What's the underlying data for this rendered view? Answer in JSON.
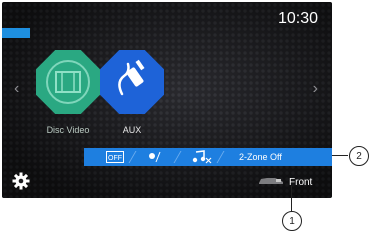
{
  "status": {
    "clock": "10:30"
  },
  "apps": [
    {
      "label": "Disc Video",
      "icon": "film-icon"
    },
    {
      "label": "AUX",
      "icon": "aux-cable-icon"
    }
  ],
  "status_bar": {
    "items": [
      {
        "icon": "off-icon",
        "text": "OFF"
      },
      {
        "icon": "day-night-icon"
      },
      {
        "icon": "music-mute-icon"
      }
    ],
    "zone_label": "2-Zone Off"
  },
  "bottom": {
    "settings_icon": "gear-icon",
    "front_label": "Front",
    "front_icon": "car-icon"
  },
  "callouts": [
    "1",
    "2"
  ],
  "colors": {
    "accent": "#1e7fe0",
    "disc_tile": "#2aa882",
    "aux_tile": "#1e63d8"
  }
}
